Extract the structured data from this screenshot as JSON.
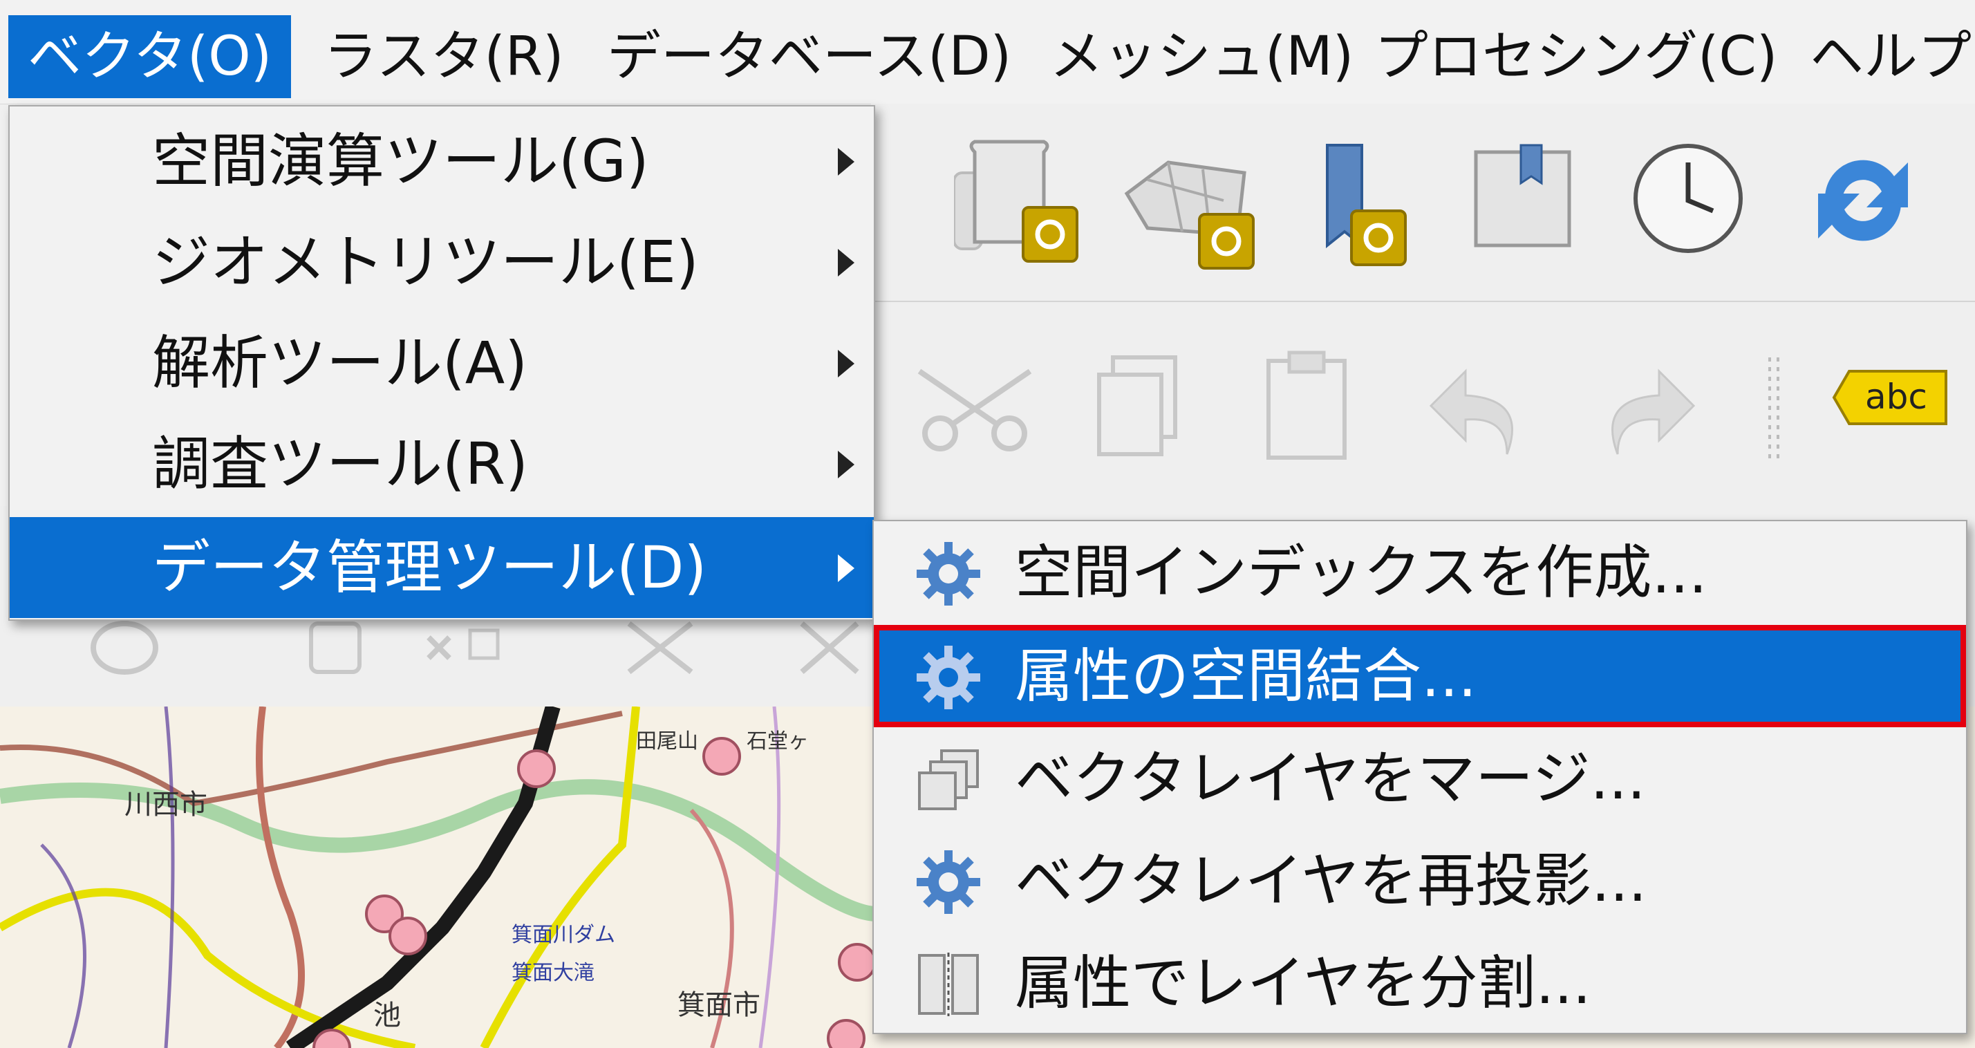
{
  "menubar": {
    "items": [
      {
        "label": "ベクタ(O)",
        "active": true
      },
      {
        "label": "ラスタ(R)"
      },
      {
        "label": "データベース(D)"
      },
      {
        "label": "メッシュ(M)"
      },
      {
        "label": "プロセシング(C)"
      },
      {
        "label": "ヘルプ("
      }
    ]
  },
  "vector_menu": {
    "items": [
      {
        "label": "空間演算ツール(G)"
      },
      {
        "label": "ジオメトリツール(E)"
      },
      {
        "label": "解析ツール(A)"
      },
      {
        "label": "調査ツール(R)"
      },
      {
        "label": "データ管理ツール(D)",
        "highlighted": true
      }
    ]
  },
  "data_management_submenu": {
    "items": [
      {
        "label": "空間インデックスを作成...",
        "icon": "gear-icon"
      },
      {
        "label": "属性の空間結合...",
        "icon": "gear-icon",
        "highlighted": true
      },
      {
        "label": "ベクタレイヤをマージ...",
        "icon": "merge-layers-icon"
      },
      {
        "label": "ベクタレイヤを再投影...",
        "icon": "gear-icon"
      },
      {
        "label": "属性でレイヤを分割...",
        "icon": "split-layer-icon"
      }
    ]
  },
  "toolbar": {
    "label_tool_text": "abc"
  },
  "map": {
    "labels": [
      "川西市",
      "箕面市",
      "石堂ヶ",
      "田尾山",
      "池",
      "箕面川ダム",
      "箕面大滝"
    ]
  },
  "colors": {
    "accent": "#0a6ed0",
    "highlight_border": "#e4000f",
    "menu_bg": "#f2f2f2"
  }
}
